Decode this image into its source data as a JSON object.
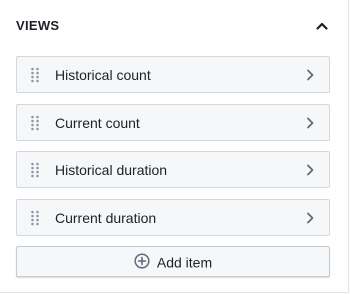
{
  "section": {
    "title": "VIEWS",
    "collapse_icon": "chevron-up-icon"
  },
  "views": [
    {
      "label": "Historical count"
    },
    {
      "label": "Current count"
    },
    {
      "label": "Historical duration"
    },
    {
      "label": "Current duration"
    }
  ],
  "add_button": {
    "label": "Add item",
    "icon": "plus-circle-icon"
  },
  "colors": {
    "item_background": "#f6f7f9",
    "item_border": "#d3d8de",
    "text": "#1c2127",
    "icon": "#5f6b7c"
  }
}
